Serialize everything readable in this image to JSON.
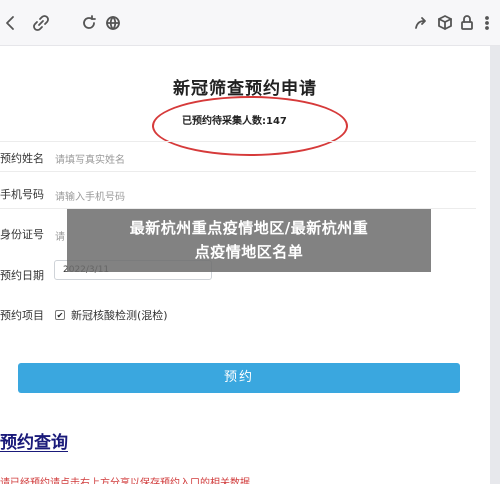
{
  "form": {
    "title": "新冠筛查预约申请",
    "count_label": "已预约待采集人数:",
    "count_value": "147",
    "fields": [
      {
        "label": "预约姓名",
        "placeholder": "请填写真实姓名"
      },
      {
        "label": "手机号码",
        "placeholder": "请输入手机号码"
      },
      {
        "label": "身份证号",
        "placeholder": "请"
      },
      {
        "label": "预约日期",
        "value": "2022/3/11"
      },
      {
        "label": "预约项目",
        "option": "新冠核酸检测(混检)",
        "checked": "✔"
      }
    ],
    "submit_label": "预约"
  },
  "query": {
    "title": "预约查询",
    "note": "请已经预约请点击右上方分享以保存预约入口的相关数据"
  },
  "banner": {
    "line1": "最新杭州重点疫情地区/最新杭州重",
    "line2": "点疫情地区名单"
  },
  "colors": {
    "accent": "#3aa7df",
    "circle": "#d63a3a",
    "link": "#1a1a7a"
  },
  "icons": [
    "back-icon",
    "link-icon",
    "refresh-icon",
    "globe-icon",
    "share-icon",
    "cube-icon",
    "lock-icon",
    "more-icon"
  ]
}
